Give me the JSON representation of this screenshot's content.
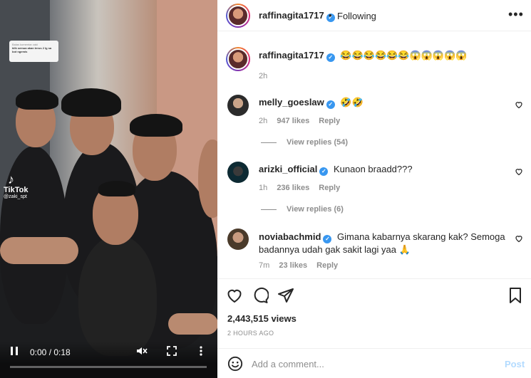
{
  "video": {
    "caption_sticker_title": "Balas komentar zaki",
    "caption_sticker_text": "klik semua akan terus 2 lg sa bot ngemis",
    "tiktok_logo": "♪",
    "tiktok_label": "TikTok",
    "tiktok_user": "@zaki_spt",
    "time": "0:00 / 0:18",
    "progress": 0.0
  },
  "header": {
    "username": "raffinagita1717",
    "dot": "•",
    "follow_label": "Following",
    "more_label": "•••"
  },
  "caption": {
    "username": "raffinagita1717",
    "text": "😂😂😂😂😂😂😱😱😱😱😱",
    "time": "2h"
  },
  "comments": [
    {
      "username": "melly_goeslaw",
      "text": "🤣🤣",
      "time": "2h",
      "likes": "947 likes",
      "reply": "Reply",
      "view_replies": "View replies (54)"
    },
    {
      "username": "arizki_official",
      "text": "Kunaon braadd???",
      "time": "1h",
      "likes": "236 likes",
      "reply": "Reply",
      "view_replies": "View replies (6)"
    },
    {
      "username": "noviabachmid",
      "text_line1": "Gimana kabarnya skarang kak? Semoga",
      "text_line2": "badannya udah gak sakit lagi yaa 🙏",
      "time": "7m",
      "likes": "23 likes",
      "reply": "Reply"
    }
  ],
  "stats": {
    "views": "2,443,515 views",
    "ago": "2 HOURS AGO"
  },
  "add_comment": {
    "placeholder": "Add a comment...",
    "post_label": "Post"
  },
  "colors": {
    "verified": "#3897f0",
    "muted": "#8e8e8e",
    "post_disabled": "#b3dbff"
  }
}
